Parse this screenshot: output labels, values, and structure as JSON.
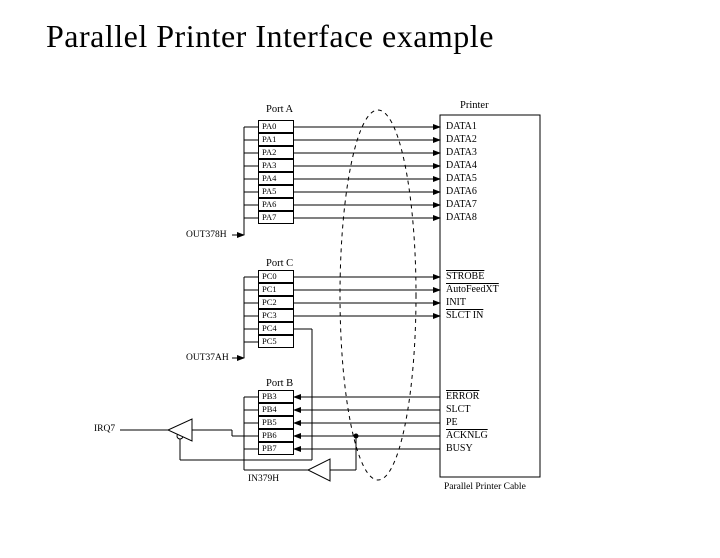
{
  "title": "Parallel Printer Interface example",
  "headers": {
    "portA": "Port A",
    "portC": "Port C",
    "portB": "Port B",
    "printer": "Printer",
    "cable": "Parallel Printer Cable"
  },
  "pa": [
    "PA0",
    "PA1",
    "PA2",
    "PA3",
    "PA4",
    "PA5",
    "PA6",
    "PA7"
  ],
  "pc": [
    "PC0",
    "PC1",
    "PC2",
    "PC3",
    "PC4",
    "PC5"
  ],
  "pb": [
    "PB3",
    "PB4",
    "PB5",
    "PB6",
    "PB7"
  ],
  "printer_data": [
    "DATA1",
    "DATA2",
    "DATA3",
    "DATA4",
    "DATA5",
    "DATA6",
    "DATA7",
    "DATA8"
  ],
  "printer_ctrl": [
    "STROBE",
    "AutoFeedXT",
    "INIT",
    "SLCT IN"
  ],
  "printer_stat": [
    "ERROR",
    "SLCT",
    "PE",
    "ACKNLG",
    "BUSY"
  ],
  "ext": {
    "out378": "OUT378H",
    "out37a": "OUT37AH",
    "in379": "IN379H",
    "irq7": "IRQ7"
  },
  "overline_flags": {
    "ctrl": [
      true,
      true,
      false,
      true
    ],
    "stat": [
      true,
      false,
      false,
      true,
      false
    ]
  }
}
